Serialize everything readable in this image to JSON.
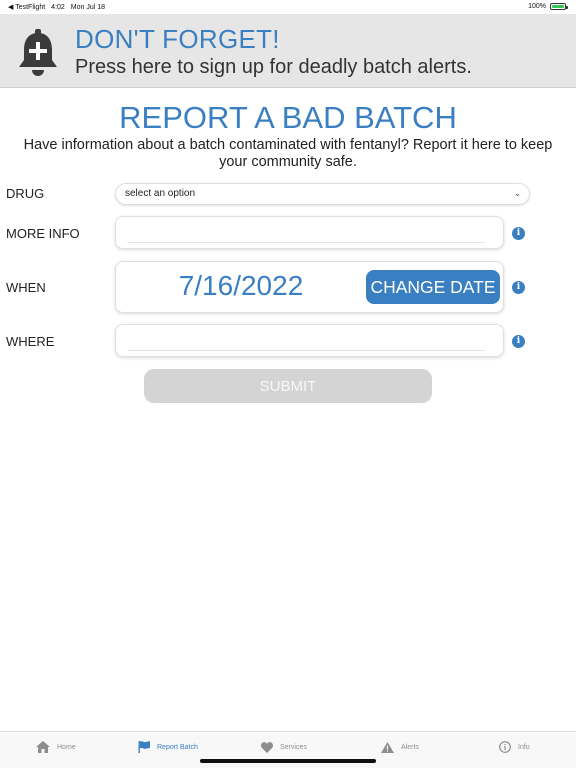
{
  "status_bar": {
    "back_app": "◀ TestFlight",
    "time": "4:02",
    "date": "Mon Jul 18",
    "battery": "100%"
  },
  "alert_banner": {
    "title": "DON'T FORGET!",
    "subtitle": "Press here to sign up for deadly batch alerts.",
    "icon": "bell-plus-icon"
  },
  "page": {
    "title": "REPORT A BAD BATCH",
    "description": "Have information about a batch contaminated with fentanyl? Report it here to keep your community safe."
  },
  "form": {
    "drug": {
      "label": "DRUG",
      "selected": "select an option"
    },
    "more_info": {
      "label": "MORE INFO",
      "value": ""
    },
    "when": {
      "label": "WHEN",
      "date": "7/16/2022",
      "change_label": "CHANGE DATE"
    },
    "where": {
      "label": "WHERE",
      "value": ""
    },
    "info_glyph": "i",
    "submit_label": "SUBMIT"
  },
  "tabs": [
    {
      "label": "Home",
      "icon": "home-icon",
      "active": false
    },
    {
      "label": "Report Batch",
      "icon": "flag-icon",
      "active": true
    },
    {
      "label": "Services",
      "icon": "heart-icon",
      "active": false
    },
    {
      "label": "Alerts",
      "icon": "warning-icon",
      "active": false
    },
    {
      "label": "Info",
      "icon": "info-circle-icon",
      "active": false
    }
  ],
  "colors": {
    "accent": "#3a7fc1",
    "banner_bg": "#e6e6e6",
    "submit_disabled": "#d4d4d4",
    "tab_inactive": "#8e8e8e"
  }
}
